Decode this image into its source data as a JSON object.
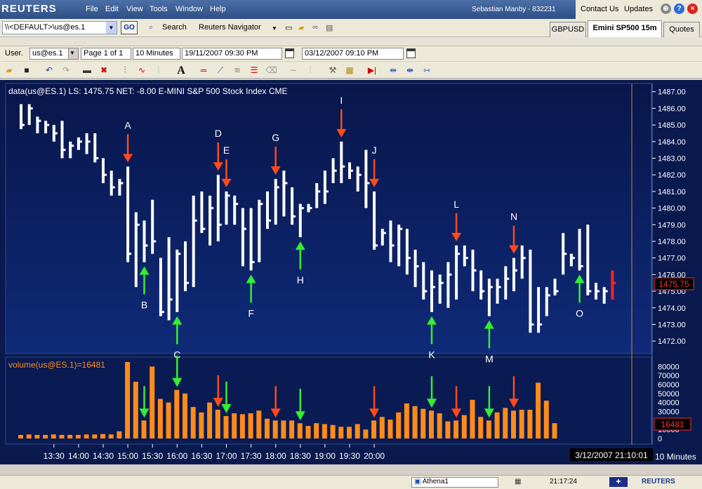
{
  "app": {
    "logo": "REUTERS",
    "menu": [
      "File",
      "Edit",
      "View",
      "Tools",
      "Window",
      "Help"
    ],
    "user": "Sebastian Manby - 832231",
    "contact": "Contact Us",
    "updates": "Updates"
  },
  "toolbar": {
    "address_value": "\\\\<DEFAULT>\\us@es.1",
    "go_label": "GO",
    "search_label": "Search",
    "navigator_label": "Reuters Navigator",
    "tabs": [
      "GBPUSD",
      "Emini SP500 15m",
      "Quotes"
    ]
  },
  "chart_toolbar": {
    "user_label": "User.",
    "ric_value": "us@es.1",
    "page_label": "Page 1 of 1",
    "interval": "10 Minutes",
    "start_date": "19/11/2007 09:30 PM",
    "end_date": "03/12/2007 09:10 PM"
  },
  "status": {
    "window_name": "Athena1",
    "clock": "21:17:24",
    "brand": "REUTERS"
  },
  "colors": {
    "bg": "#0c1d54",
    "bar": "#ffffff",
    "volume": "#ff8c1a",
    "down_arrow": "#ff4a1a",
    "up_arrow": "#33ee33",
    "last_bar": "#ff2222"
  },
  "chart_data": [
    {
      "type": "ohlc",
      "title": "data(us@ES.1) LS: 1475.75  NET: -8.00   E-MINI S&P 500 Stock Index CME",
      "last_price": "1475.75",
      "ylim": [
        1471.5,
        1487.2
      ],
      "yticks": [
        "1472.00",
        "1473.00",
        "1474.00",
        "1475.00",
        "1476.00",
        "1477.00",
        "1478.00",
        "1479.00",
        "1480.00",
        "1481.00",
        "1482.00",
        "1483.00",
        "1484.00",
        "1485.00",
        "1486.00",
        "1487.00"
      ],
      "bars": [
        [
          1486.25,
          1484.75,
          1485.0
        ],
        [
          1486.25,
          1485.0,
          1486.0
        ],
        [
          1485.5,
          1484.5,
          1485.25
        ],
        [
          1485.25,
          1484.5,
          1485.0
        ],
        [
          1485.0,
          1484.0,
          1484.5
        ],
        [
          1485.25,
          1483.0,
          1483.5
        ],
        [
          1484.0,
          1483.0,
          1483.75
        ],
        [
          1484.25,
          1483.5,
          1484.0
        ],
        [
          1484.5,
          1483.25,
          1484.0
        ],
        [
          1484.5,
          1482.75,
          1483.0
        ],
        [
          1483.0,
          1481.5,
          1482.0
        ],
        [
          1482.25,
          1480.75,
          1481.25
        ],
        [
          1481.75,
          1480.75,
          1481.5
        ],
        [
          1482.5,
          1476.75,
          1477.25
        ],
        [
          1479.75,
          1475.25,
          1479.0
        ],
        [
          1479.25,
          1476.75,
          1477.75
        ],
        [
          1480.5,
          1477.25,
          1478.0
        ],
        [
          1477.0,
          1473.5,
          1473.75
        ],
        [
          1478.25,
          1473.25,
          1474.5
        ],
        [
          1477.5,
          1473.75,
          1477.25
        ],
        [
          1478.0,
          1475.0,
          1475.5
        ],
        [
          1480.75,
          1475.25,
          1479.25
        ],
        [
          1481.0,
          1478.5,
          1478.75
        ],
        [
          1480.75,
          1477.75,
          1480.0
        ],
        [
          1482.0,
          1478.0,
          1479.0
        ],
        [
          1481.0,
          1479.0,
          1480.75
        ],
        [
          1480.75,
          1479.0,
          1480.25
        ],
        [
          1480.0,
          1476.5,
          1478.75
        ],
        [
          1480.0,
          1476.25,
          1476.75
        ],
        [
          1480.5,
          1476.75,
          1480.25
        ],
        [
          1481.0,
          1478.75,
          1479.25
        ],
        [
          1481.75,
          1479.0,
          1481.25
        ],
        [
          1482.25,
          1479.5,
          1481.5
        ],
        [
          1481.25,
          1479.0,
          1479.5
        ],
        [
          1480.25,
          1478.25,
          1480.0
        ],
        [
          1480.25,
          1479.75,
          1480.0
        ],
        [
          1481.5,
          1480.0,
          1481.0
        ],
        [
          1482.25,
          1480.25,
          1481.0
        ],
        [
          1483.0,
          1481.5,
          1482.25
        ],
        [
          1484.0,
          1481.5,
          1482.5
        ],
        [
          1482.75,
          1481.75,
          1482.25
        ],
        [
          1482.5,
          1481.0,
          1482.0
        ],
        [
          1483.5,
          1480.0,
          1481.5
        ],
        [
          1481.0,
          1477.5,
          1477.75
        ],
        [
          1478.75,
          1477.75,
          1478.5
        ],
        [
          1479.25,
          1476.75,
          1477.75
        ],
        [
          1479.0,
          1476.5,
          1478.75
        ],
        [
          1478.75,
          1476.0,
          1477.0
        ],
        [
          1477.5,
          1475.25,
          1476.5
        ],
        [
          1476.75,
          1474.5,
          1475.0
        ],
        [
          1476.25,
          1473.75,
          1475.25
        ],
        [
          1476.0,
          1474.25,
          1475.5
        ],
        [
          1476.75,
          1474.0,
          1476.0
        ],
        [
          1477.75,
          1474.5,
          1477.25
        ],
        [
          1477.75,
          1476.5,
          1477.0
        ],
        [
          1477.5,
          1475.0,
          1476.25
        ],
        [
          1476.25,
          1474.5,
          1475.0
        ],
        [
          1475.75,
          1473.5,
          1475.25
        ],
        [
          1475.75,
          1474.25,
          1475.25
        ],
        [
          1476.5,
          1474.5,
          1475.75
        ],
        [
          1477.0,
          1475.0,
          1476.25
        ],
        [
          1477.75,
          1475.75,
          1477.0
        ],
        [
          1477.5,
          1472.5,
          1473.0
        ],
        [
          1475.25,
          1472.5,
          1473.0
        ],
        [
          1475.25,
          1473.5,
          1474.75
        ],
        [
          1475.75,
          1474.75,
          1475.0
        ],
        [
          1478.5,
          1476.0,
          1477.25
        ],
        [
          1477.25,
          1476.5,
          1477.0
        ],
        [
          1478.75,
          1476.25,
          1476.5
        ],
        [
          1479.0,
          1474.75,
          1475.0
        ],
        [
          1475.5,
          1474.5,
          1475.0
        ],
        [
          1475.25,
          1474.25,
          1475.0
        ],
        [
          1476.25,
          1474.5,
          1475.5
        ]
      ],
      "xticks": [
        "13:30",
        "14:00",
        "14:30",
        "15:00",
        "15:30",
        "16:00",
        "16:30",
        "17:00",
        "17:30",
        "18:00",
        "18:30",
        "19:00",
        "19:30",
        "20:00"
      ],
      "x_unit": "10 Minutes",
      "cursor_label": "3/12/2007 21:10:01",
      "annotations": [
        {
          "label": "A",
          "bar": 13,
          "dir": "down"
        },
        {
          "label": "B",
          "bar": 15,
          "dir": "up"
        },
        {
          "label": "C",
          "bar": 19,
          "dir": "up"
        },
        {
          "label": "D",
          "bar": 24,
          "dir": "down"
        },
        {
          "label": "E",
          "bar": 25,
          "dir": "down"
        },
        {
          "label": "F",
          "bar": 28,
          "dir": "up"
        },
        {
          "label": "G",
          "bar": 31,
          "dir": "down"
        },
        {
          "label": "H",
          "bar": 34,
          "dir": "up"
        },
        {
          "label": "I",
          "bar": 39,
          "dir": "down"
        },
        {
          "label": "J",
          "bar": 43,
          "dir": "down"
        },
        {
          "label": "K",
          "bar": 50,
          "dir": "up"
        },
        {
          "label": "L",
          "bar": 53,
          "dir": "down"
        },
        {
          "label": "M",
          "bar": 57,
          "dir": "up"
        },
        {
          "label": "N",
          "bar": 60,
          "dir": "down"
        },
        {
          "label": "O",
          "bar": 68,
          "dir": "up"
        }
      ]
    },
    {
      "type": "bar",
      "title": "volume(us@ES.1)=16481",
      "last_volume": "16481",
      "ylim": [
        0,
        85000
      ],
      "yticks": [
        "0",
        "10000",
        "20000",
        "30000",
        "40000",
        "50000",
        "60000",
        "70000",
        "80000"
      ],
      "values": [
        4000,
        4500,
        4000,
        4000,
        4500,
        4000,
        4000,
        4000,
        4500,
        4500,
        5000,
        4500,
        8000,
        85000,
        63000,
        20000,
        80000,
        44000,
        40000,
        54000,
        50000,
        35000,
        29000,
        40000,
        32000,
        25000,
        28000,
        27000,
        28000,
        31000,
        22000,
        20000,
        20000,
        20000,
        17000,
        14000,
        17000,
        16000,
        15000,
        13000,
        13000,
        16000,
        10000,
        20000,
        24000,
        21000,
        29000,
        39000,
        36000,
        33000,
        31000,
        28000,
        19000,
        20000,
        26000,
        43000,
        24000,
        20000,
        29000,
        34000,
        31000,
        32000,
        32000,
        62000,
        42000,
        17000
      ],
      "volume_arrows": [
        {
          "bar": 15,
          "dir": "up",
          "color": "green"
        },
        {
          "bar": 19,
          "dir": "up",
          "color": "green"
        },
        {
          "bar": 24,
          "dir": "down",
          "color": "red"
        },
        {
          "bar": 25,
          "dir": "up",
          "color": "green"
        },
        {
          "bar": 31,
          "dir": "down",
          "color": "red"
        },
        {
          "bar": 34,
          "dir": "up",
          "color": "green"
        },
        {
          "bar": 43,
          "dir": "down",
          "color": "red"
        },
        {
          "bar": 50,
          "dir": "up",
          "color": "green"
        },
        {
          "bar": 53,
          "dir": "down",
          "color": "red"
        },
        {
          "bar": 57,
          "dir": "up",
          "color": "green"
        },
        {
          "bar": 60,
          "dir": "down",
          "color": "red"
        }
      ]
    }
  ]
}
